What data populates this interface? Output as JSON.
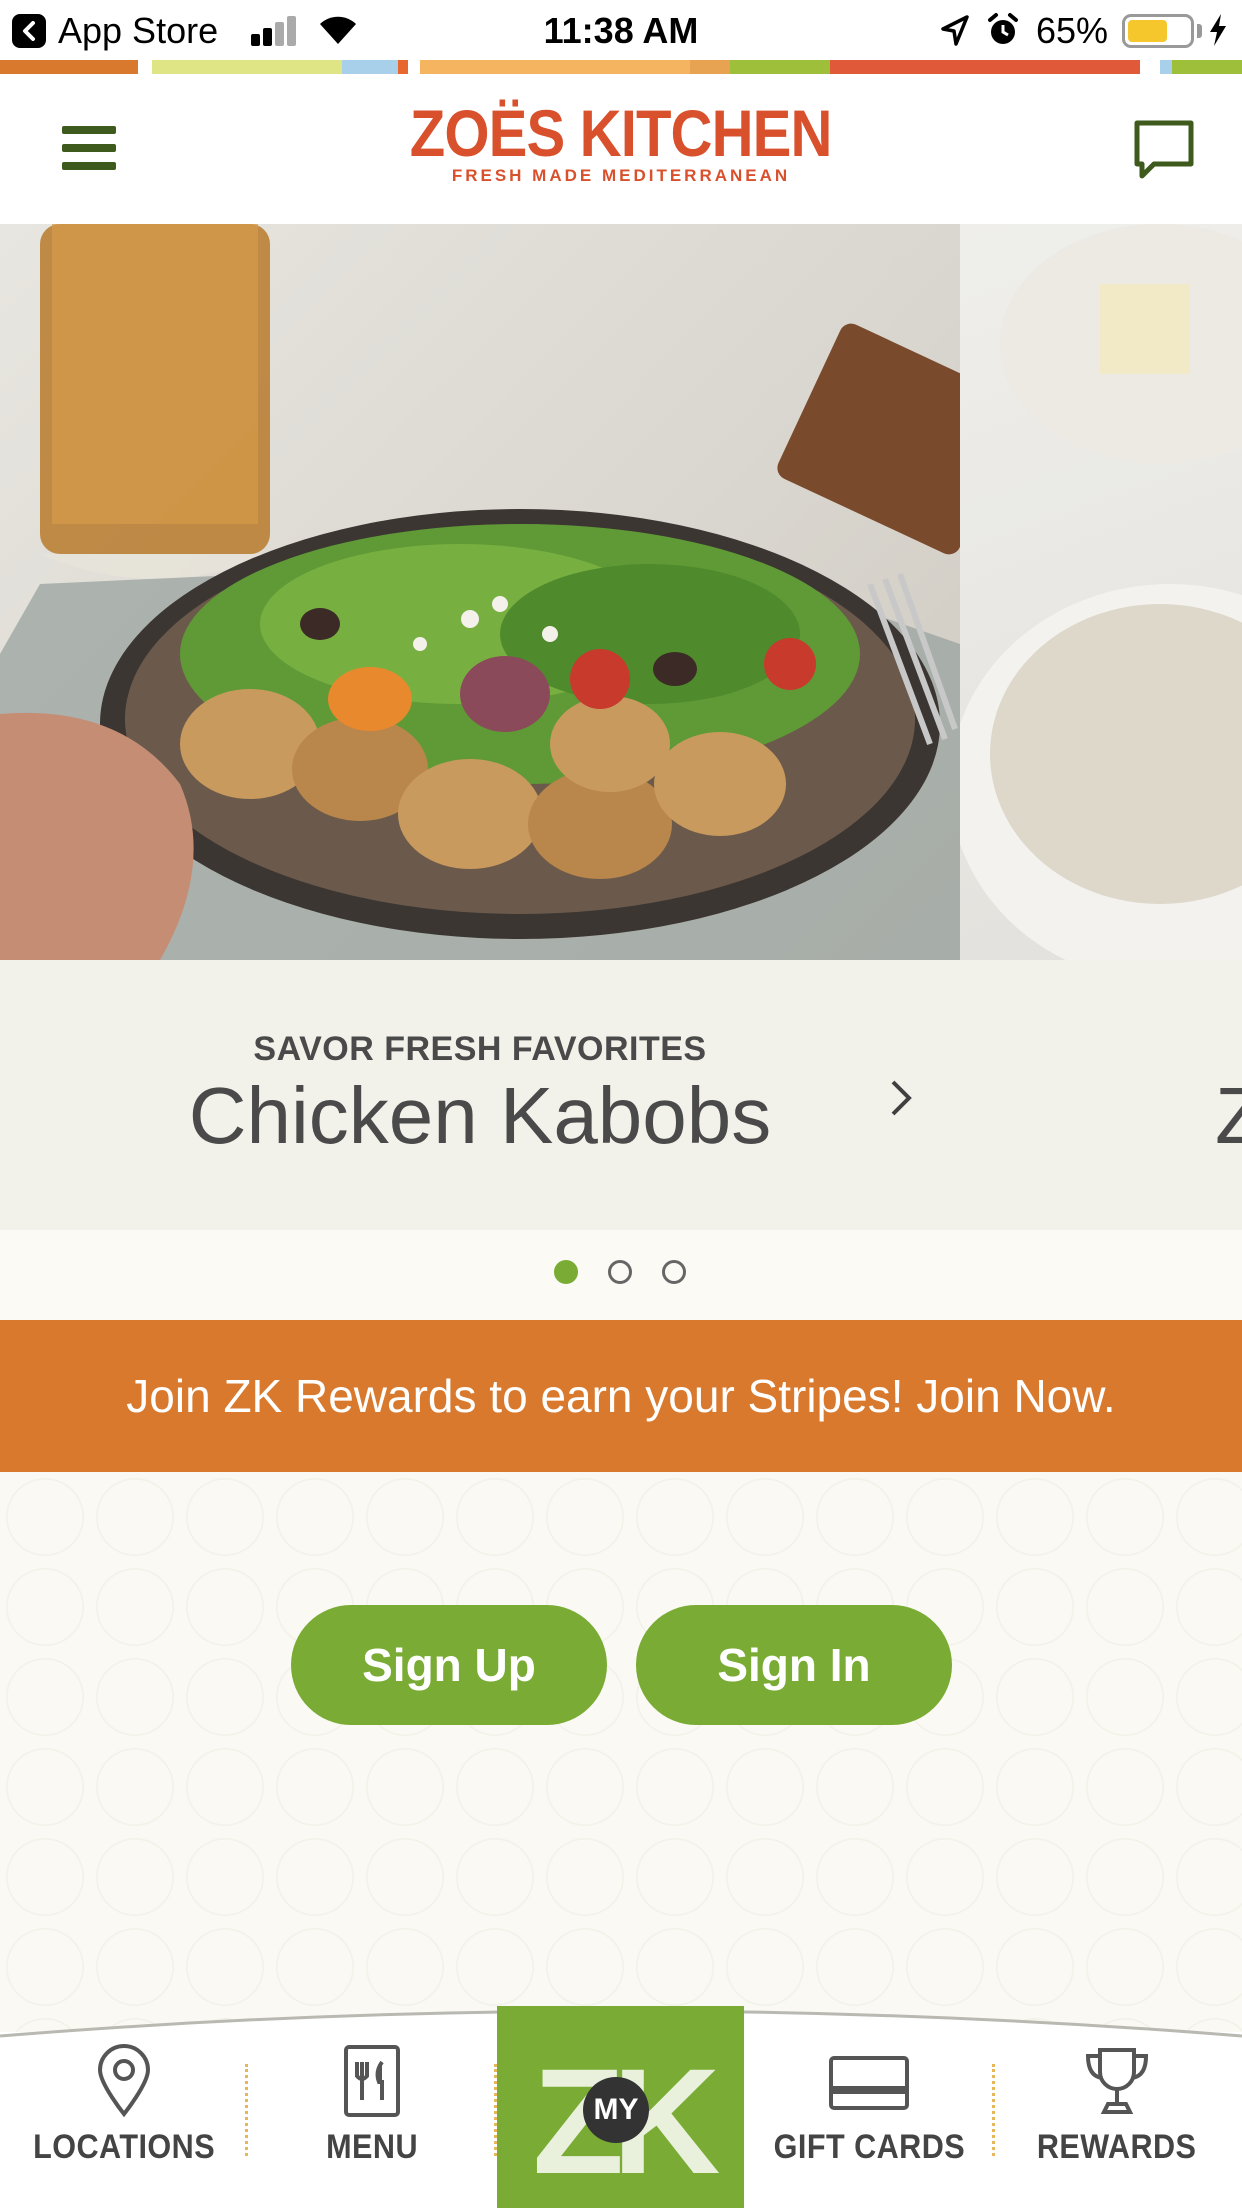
{
  "status_bar": {
    "back_app": "App Store",
    "time": "11:38 AM",
    "battery_percent": "65%",
    "battery_level": 0.65
  },
  "stripe_colors": [
    "#d9792e",
    "#ffffff",
    "#dfe585",
    "#a9d0ea",
    "#e8672f",
    "#ffffff",
    "#f4b460",
    "#e8a352",
    "#9dbf3a",
    "#e05a3a",
    "#ffffff",
    "#a9d0ea",
    "#9dbf3a"
  ],
  "header": {
    "logo_main": "ZOËS KITCHEN",
    "logo_sub": "FRESH MADE MEDITERRANEAN"
  },
  "carousel": {
    "eyebrow": "SAVOR FRESH FAVORITES",
    "title": "Chicken Kabobs",
    "next_title_peek": "Z",
    "active_index": 0,
    "slide_count": 3
  },
  "rewards_banner": {
    "text": "Join ZK Rewards to earn your Stripes! Join Now."
  },
  "auth": {
    "sign_up": "Sign Up",
    "sign_in": "Sign In"
  },
  "bottom_nav": {
    "locations": "LOCATIONS",
    "menu": "MENU",
    "myzk_logo": "ZK",
    "myzk_badge": "MY",
    "gift_cards": "GIFT CARDS",
    "rewards": "REWARDS"
  },
  "colors": {
    "brand_orange": "#d9512c",
    "banner_orange": "#d8792e",
    "brand_green": "#7aac35",
    "dark_green": "#3e5a1d"
  }
}
